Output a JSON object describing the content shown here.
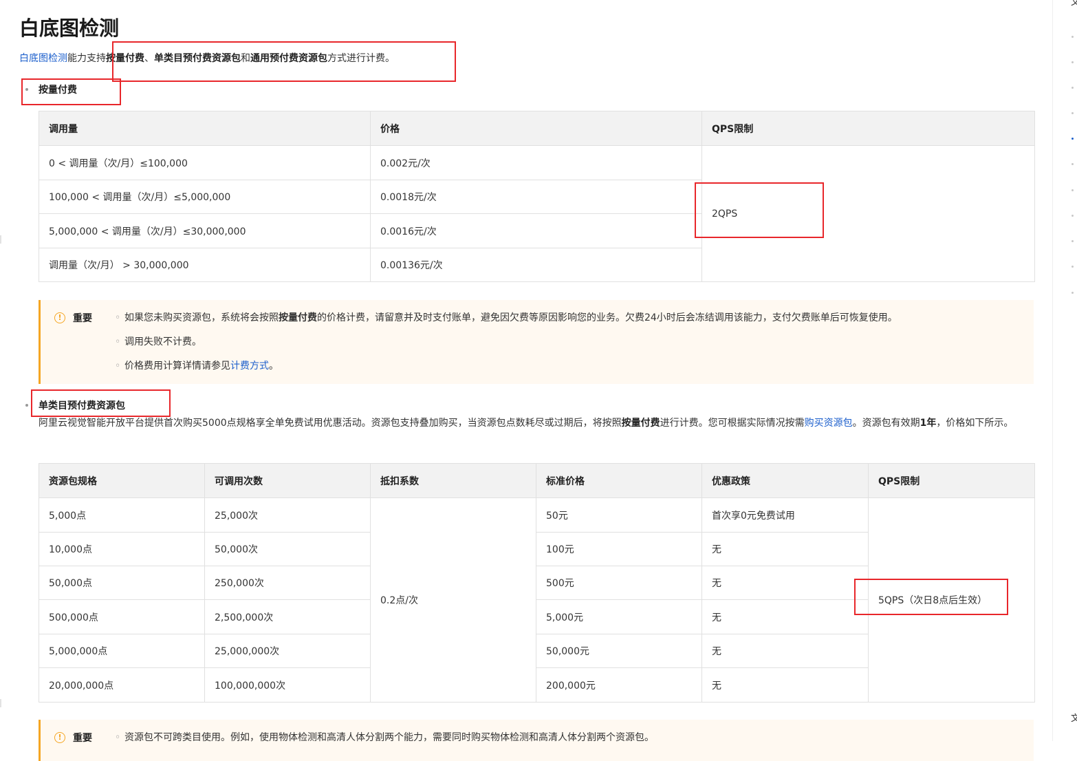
{
  "page": {
    "title": "白底图检测",
    "intro": {
      "link": "白底图检测",
      "t1": "能力支持",
      "b1": "按量付费",
      "t2": "、",
      "b2": "单类目预付费资源包",
      "t3": "和",
      "b3": "通用预付费资源包",
      "t4": "方式进行计费。"
    }
  },
  "pay_as_you_go": {
    "heading": "按量付费",
    "headers": [
      "调用量",
      "价格",
      "QPS限制"
    ],
    "rows": [
      {
        "volume": "0 < 调用量（次/月）≤100,000",
        "price": "0.002元/次"
      },
      {
        "volume": "100,000 < 调用量（次/月）≤5,000,000",
        "price": "0.0018元/次"
      },
      {
        "volume": "5,000,000 < 调用量（次/月）≤30,000,000",
        "price": "0.0016元/次"
      },
      {
        "volume": "调用量（次/月） > 30,000,000",
        "price": "0.00136元/次"
      }
    ],
    "qps": "2QPS"
  },
  "notice1": {
    "label": "重要",
    "items": [
      {
        "before": "如果您未购买资源包，系统将会按照",
        "bold": "按量付费",
        "after": "的价格计费，请留意并及时支付账单，避免因欠费等原因影响您的业务。欠费24小时后会冻结调用该能力，支付欠费账单后可恢复使用。"
      },
      {
        "before": "调用失败不计费。",
        "bold": "",
        "after": ""
      },
      {
        "before": "价格费用计算详情请参见",
        "link": "计费方式",
        "after": "。"
      }
    ]
  },
  "prepaid": {
    "heading": "单类目预付费资源包",
    "para": {
      "t1": "阿里云视觉智能开放平台提供首次购买5000点规格享全单免费试用优惠活动。资源包支持叠加购买，当资源包点数耗尽或过期后，将按照",
      "b1": "按量付费",
      "t2": "进行计费。您可根据实际情况按需",
      "link": "购买资源包",
      "t3": "。资源包有效期",
      "b2": "1年",
      "t4": "，价格如下所示。"
    },
    "headers": [
      "资源包规格",
      "可调用次数",
      "抵扣系数",
      "标准价格",
      "优惠政策",
      "QPS限制"
    ],
    "rows": [
      {
        "spec": "5,000点",
        "calls": "25,000次",
        "price": "50元",
        "policy": "首次享0元免费试用"
      },
      {
        "spec": "10,000点",
        "calls": "50,000次",
        "price": "100元",
        "policy": "无"
      },
      {
        "spec": "50,000点",
        "calls": "250,000次",
        "price": "500元",
        "policy": "无"
      },
      {
        "spec": "500,000点",
        "calls": "2,500,000次",
        "price": "5,000元",
        "policy": "无"
      },
      {
        "spec": "5,000,000点",
        "calls": "25,000,000次",
        "price": "50,000元",
        "policy": "无"
      },
      {
        "spec": "20,000,000点",
        "calls": "100,000,000次",
        "price": "200,000元",
        "policy": "无"
      }
    ],
    "coefficient": "0.2点/次",
    "qps": "5QPS（次日8点后生效）"
  },
  "notice2": {
    "label": "重要",
    "text": "资源包不可跨类目使用。例如，使用物体检测和高清人体分割两个能力，需要同时购买物体检测和高清人体分割两个资源包。"
  },
  "rail": {
    "top_char": "文",
    "bottom_char": "文"
  },
  "colors": {
    "link": "#1c5fcc",
    "highlight_box": "#e8262a",
    "notice_border": "#f5a623",
    "notice_bg": "#fff9f1"
  }
}
